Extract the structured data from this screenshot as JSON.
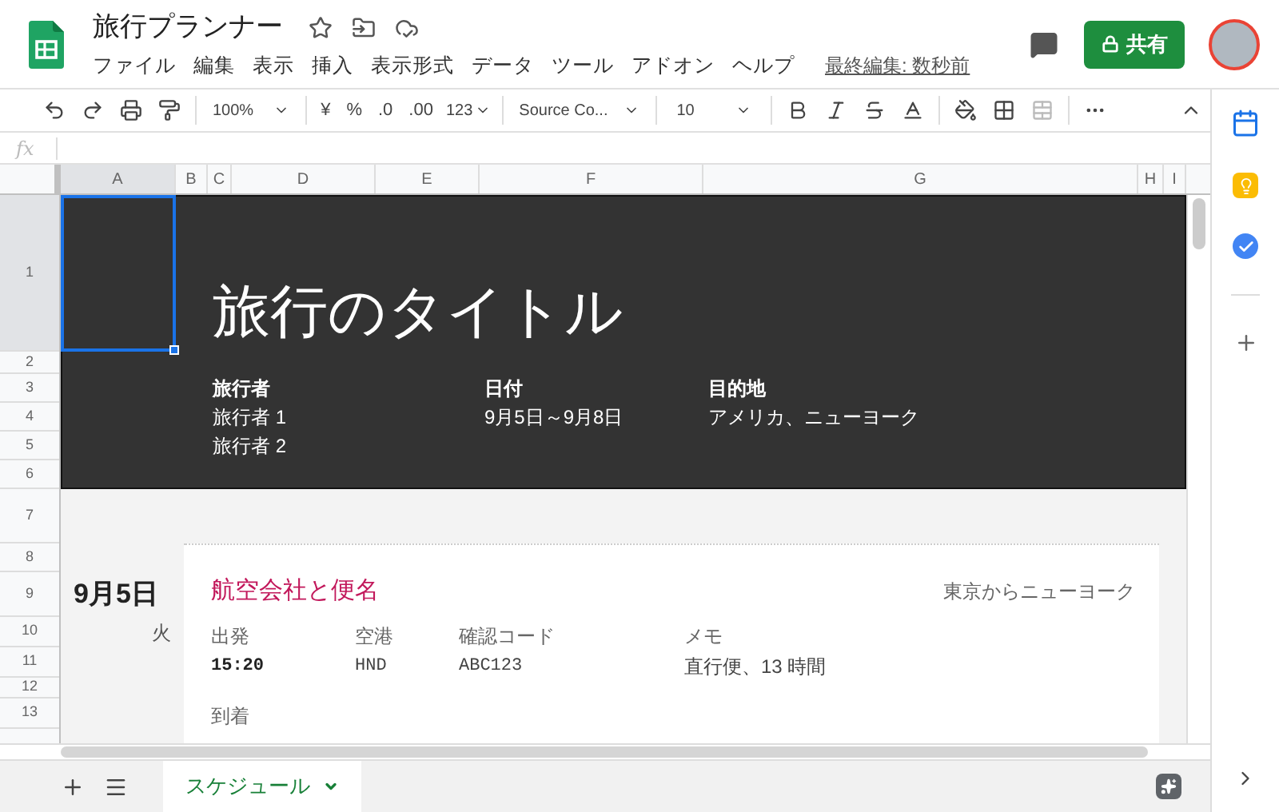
{
  "app": {
    "title": "旅行プランナー",
    "last_edit": "最終編集: 数秒前",
    "share_button": "共有"
  },
  "menus": [
    "ファイル",
    "編集",
    "表示",
    "挿入",
    "表示形式",
    "データ",
    "ツール",
    "アドオン",
    "ヘルプ"
  ],
  "toolbar": {
    "zoom": "100%",
    "currency": "¥",
    "percent": "%",
    "decrease_decimals": ".0",
    "increase_decimals": ".00",
    "number_format": "123",
    "font": "Source Co...",
    "font_size": "10"
  },
  "formula_bar": {
    "label": "fx"
  },
  "columns": [
    {
      "label": "A",
      "selected": true
    },
    {
      "label": "B",
      "selected": false
    },
    {
      "label": "C",
      "selected": false
    },
    {
      "label": "D",
      "selected": false
    },
    {
      "label": "E",
      "selected": false
    },
    {
      "label": "F",
      "selected": false
    },
    {
      "label": "G",
      "selected": false
    },
    {
      "label": "H",
      "selected": false
    },
    {
      "label": "I",
      "selected": false
    }
  ],
  "rows": [
    {
      "label": "1",
      "selected": true
    },
    {
      "label": "2",
      "selected": false
    },
    {
      "label": "3",
      "selected": false
    },
    {
      "label": "4",
      "selected": false
    },
    {
      "label": "5",
      "selected": false
    },
    {
      "label": "6",
      "selected": false
    },
    {
      "label": "7",
      "selected": false
    },
    {
      "label": "8",
      "selected": false
    },
    {
      "label": "9",
      "selected": false
    },
    {
      "label": "10",
      "selected": false
    },
    {
      "label": "11",
      "selected": false
    },
    {
      "label": "12",
      "selected": false
    },
    {
      "label": "13",
      "selected": false
    }
  ],
  "header_band": {
    "title": "旅行のタイトル",
    "fields": [
      {
        "label": "旅行者",
        "values": [
          "旅行者 1",
          "旅行者 2"
        ]
      },
      {
        "label": "日付",
        "values": [
          "9月5日～9月8日"
        ]
      },
      {
        "label": "目的地",
        "values": [
          "アメリカ、ニューヨーク"
        ]
      }
    ]
  },
  "day": {
    "date": "9月5日",
    "weekday": "火"
  },
  "flight_card": {
    "title": "航空会社と便名",
    "route": "東京からニューヨーク",
    "columns": [
      {
        "label": "出発",
        "value": "15:20",
        "kind": "time"
      },
      {
        "label": "空港",
        "value": "HND",
        "kind": "code"
      },
      {
        "label": "確認コード",
        "value": "ABC123",
        "kind": "code"
      },
      {
        "label": "メモ",
        "value": "直行便、13 時間",
        "kind": "text"
      }
    ],
    "arrival_label": "到着"
  },
  "sheet_tabs": [
    {
      "label": "スケジュール",
      "selected": true
    }
  ]
}
